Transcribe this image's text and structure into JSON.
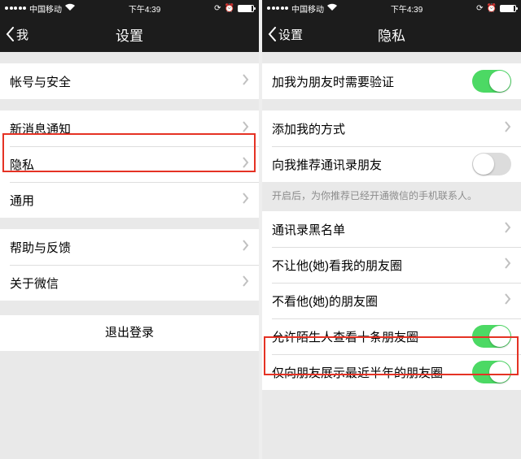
{
  "status": {
    "carrier": "中国移动",
    "time": "下午4:39"
  },
  "left": {
    "back": "我",
    "title": "设置",
    "group1": {
      "account_security": "帐号与安全"
    },
    "group2": {
      "new_msg": "新消息通知",
      "privacy": "隐私",
      "general": "通用"
    },
    "group3": {
      "help": "帮助与反馈",
      "about": "关于微信"
    },
    "logout": "退出登录"
  },
  "right": {
    "back": "设置",
    "title": "隐私",
    "group1": {
      "require_verify": "加我为朋友时需要验证"
    },
    "group2": {
      "add_method": "添加我的方式",
      "recommend": "向我推荐通讯录朋友",
      "recommend_hint": "开启后，为你推荐已经开通微信的手机联系人。"
    },
    "group3": {
      "blacklist": "通讯录黑名单",
      "hide_my": "不让他(她)看我的朋友圈",
      "hide_their": "不看他(她)的朋友圈",
      "stranger_ten": "允许陌生人查看十条朋友圈",
      "half_year": "仅向朋友展示最近半年的朋友圈"
    }
  }
}
